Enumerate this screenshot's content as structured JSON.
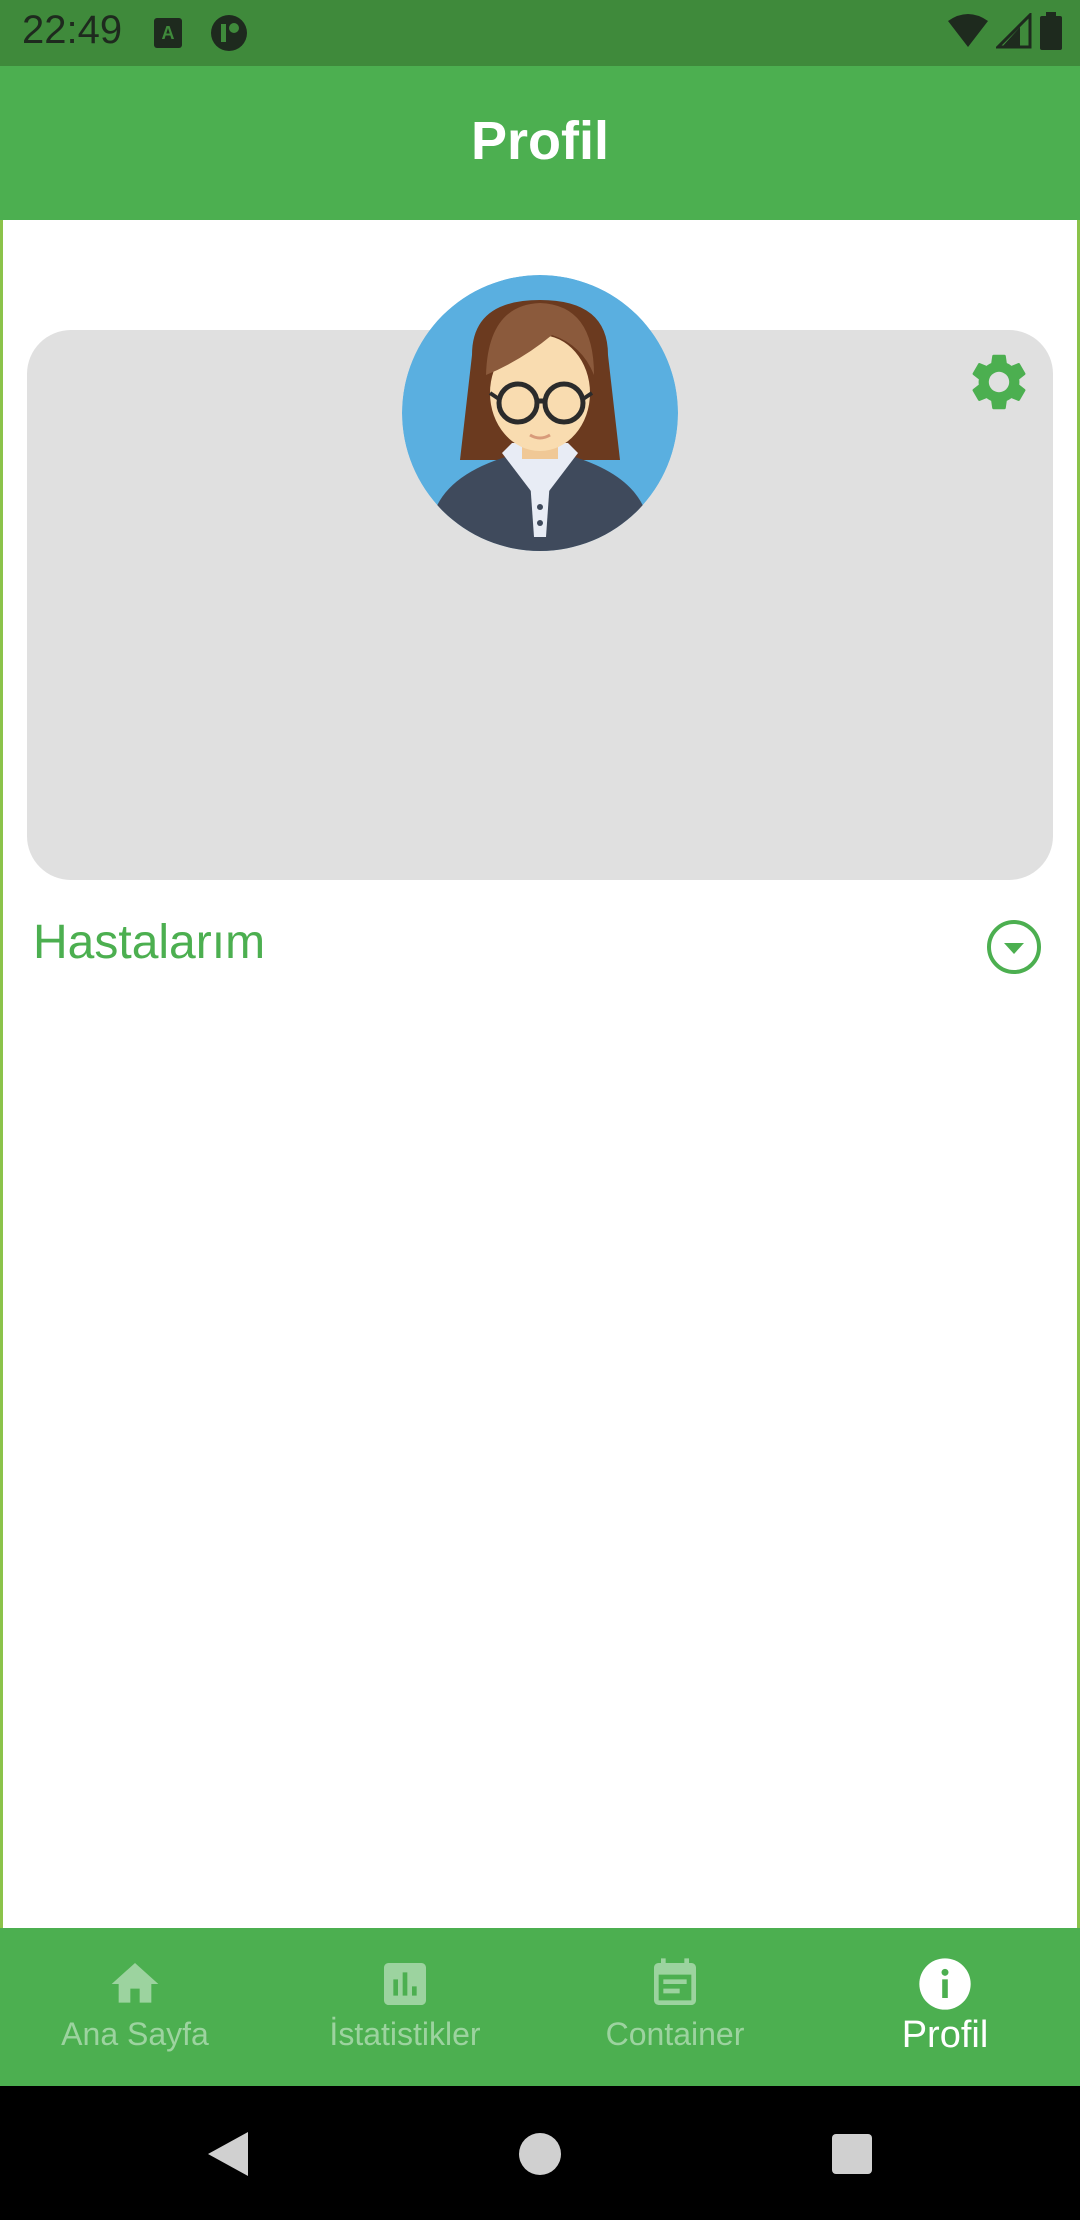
{
  "status_bar": {
    "time": "22:49",
    "icons": [
      "app-a-icon",
      "app-b-icon",
      "wifi-icon",
      "signal-icon",
      "battery-icon"
    ]
  },
  "app_bar": {
    "title": "Profil"
  },
  "profile": {
    "avatar_icon": "woman-with-glasses-avatar",
    "settings_icon": "gear-icon"
  },
  "section": {
    "title": "Hastalarım",
    "expand_icon": "chevron-down-circle-icon"
  },
  "bottom_nav": {
    "items": [
      {
        "label": "Ana Sayfa",
        "icon": "home-icon",
        "active": false
      },
      {
        "label": "İstatistikler",
        "icon": "bar-chart-icon",
        "active": false
      },
      {
        "label": "Container",
        "icon": "calendar-icon",
        "active": false
      },
      {
        "label": "Profil",
        "icon": "info-icon",
        "active": true
      }
    ]
  },
  "system_nav": {
    "buttons": [
      "back-icon",
      "home-circle-icon",
      "recents-icon"
    ]
  },
  "colors": {
    "primary": "#4caf50",
    "status_bar": "#3f8a3b",
    "card_bg": "#e0e0e0",
    "avatar_bg": "#5aafe0"
  }
}
